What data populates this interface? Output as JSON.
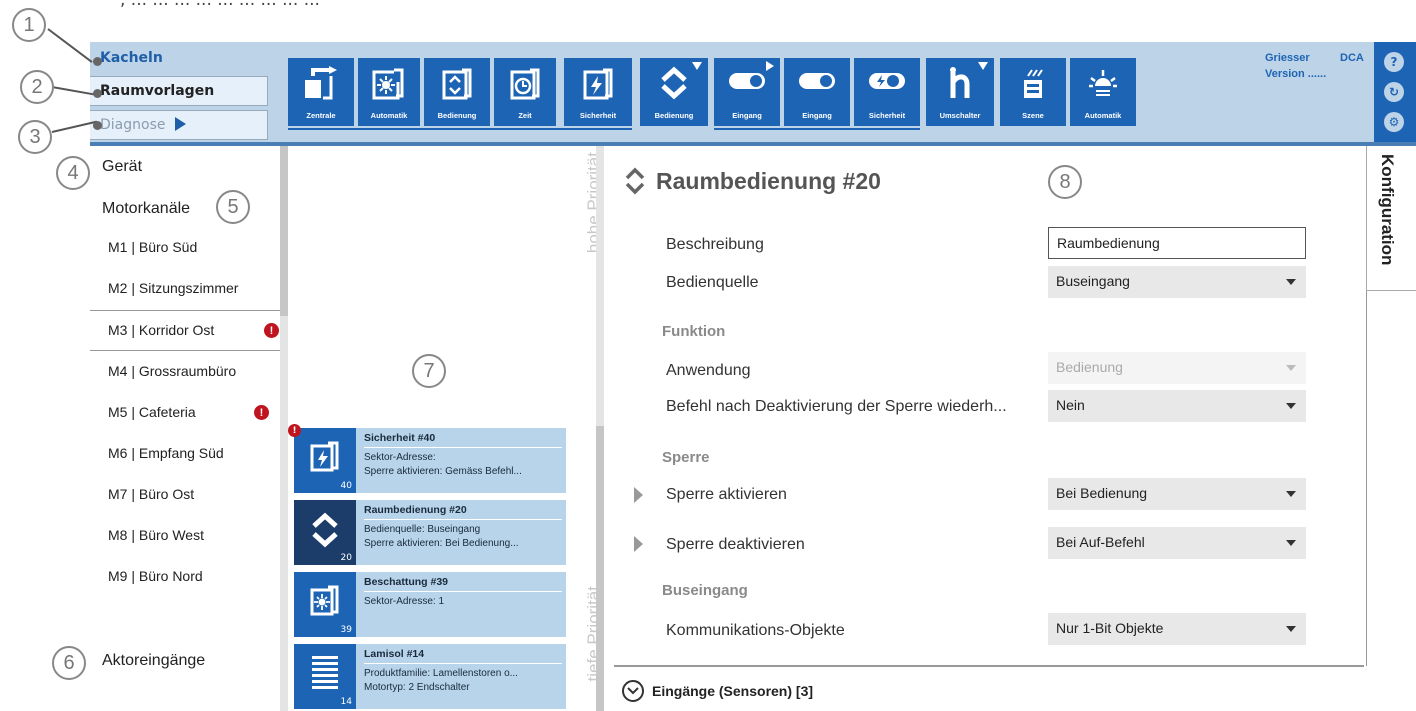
{
  "top_cut_text": ", ... ... ... ... ... ... ... ... ...",
  "callouts": [
    "1",
    "2",
    "3",
    "4",
    "5",
    "6",
    "7",
    "8"
  ],
  "nav": {
    "kacheln": "Kacheln",
    "raumvorlagen": "Raumvorlagen",
    "diagnose": "Diagnose"
  },
  "toolbar": [
    {
      "label": "Zentrale",
      "icon": "zentrale-icon"
    },
    {
      "label": "Automatik",
      "icon": "automatik-sun-icon"
    },
    {
      "label": "Bedienung",
      "icon": "bedienung-icon"
    },
    {
      "label": "Zeit",
      "icon": "clock-icon"
    },
    {
      "label": "Sicherheit",
      "icon": "lightning-icon"
    },
    {
      "label": "Bedienung",
      "icon": "up-down-chevron-icon"
    },
    {
      "label": "Eingang",
      "icon": "toggle-icon"
    },
    {
      "label": "Eingang",
      "icon": "toggle-icon"
    },
    {
      "label": "Sicherheit",
      "icon": "lightning-toggle-icon"
    },
    {
      "label": "Umschalter",
      "icon": "switch-icon"
    },
    {
      "label": "Szene",
      "icon": "scene-icon"
    },
    {
      "label": "Automatik",
      "icon": "sun-icon"
    }
  ],
  "header_info": {
    "brand": "Griesser",
    "product": "DCA",
    "version": "Version ......"
  },
  "side_buttons": [
    "help-icon",
    "refresh-icon",
    "settings-icon"
  ],
  "left": {
    "geraet": "Gerät",
    "motorkanaele": "Motorkanäle",
    "aktoreingaenge": "Aktoreingänge",
    "items": [
      {
        "label": "M1 | Büro Süd",
        "warning": false
      },
      {
        "label": "M2 | Sitzungszimmer",
        "warning": false
      },
      {
        "label": "M3 | Korridor Ost",
        "warning": true
      },
      {
        "label": "M4 | Grossraumbüro",
        "warning": false
      },
      {
        "label": "M5 | Cafeteria",
        "warning": true
      },
      {
        "label": "M6 | Empfang Süd",
        "warning": false
      },
      {
        "label": "M7 | Büro Ost",
        "warning": false
      },
      {
        "label": "M8 | Büro West",
        "warning": false
      },
      {
        "label": "M9 | Büro Nord",
        "warning": false
      }
    ]
  },
  "middle": {
    "high_priority": "hohe Priorität",
    "low_priority": "tiefe Priorität",
    "cards": [
      {
        "title": "Sicherheit #40",
        "line1": "Sektor-Adresse:",
        "line2": "Sperre aktivieren: Gemäss Befehl...",
        "num": "40",
        "warning": true
      },
      {
        "title": "Raumbedienung #20",
        "line1": "Bedienquelle: Buseingang",
        "line2": "Sperre aktivieren: Bei Bedienung...",
        "num": "20",
        "warning": false
      },
      {
        "title": "Beschattung #39",
        "line1": "Sektor-Adresse: 1",
        "line2": "",
        "num": "39",
        "warning": false
      },
      {
        "title": "Lamisol #14",
        "line1": "Produktfamilie: Lamellenstoren o...",
        "line2": "Motortyp: 2 Endschalter",
        "num": "14",
        "warning": false
      }
    ]
  },
  "right": {
    "title": "Raumbedienung #20",
    "konfiguration": "Konfiguration",
    "beschreibung_label": "Beschreibung",
    "beschreibung_value": "Raumbedienung",
    "bedienquelle_label": "Bedienquelle",
    "bedienquelle_value": "Buseingang",
    "funktion_section": "Funktion",
    "anwendung_label": "Anwendung",
    "anwendung_value": "Bedienung",
    "befehl_label": "Befehl nach Deaktivierung der Sperre wiederh...",
    "befehl_value": "Nein",
    "sperre_section": "Sperre",
    "sperre_aktivieren_label": "Sperre aktivieren",
    "sperre_aktivieren_value": "Bei Bedienung",
    "sperre_deaktivieren_label": "Sperre deaktivieren",
    "sperre_deaktivieren_value": "Bei Auf-Befehl",
    "buseingang_section": "Buseingang",
    "kommunikation_label": "Kommunikations-Objekte",
    "kommunikation_value": "Nur 1-Bit Objekte",
    "eingaenge_label": "Eingänge (Sensoren) [3]"
  },
  "colors": {
    "header_bg": "#bcd3e8",
    "tile_blue": "#1e64b4",
    "card_bg": "#b8d4ea",
    "warning_red": "#c0141e"
  }
}
